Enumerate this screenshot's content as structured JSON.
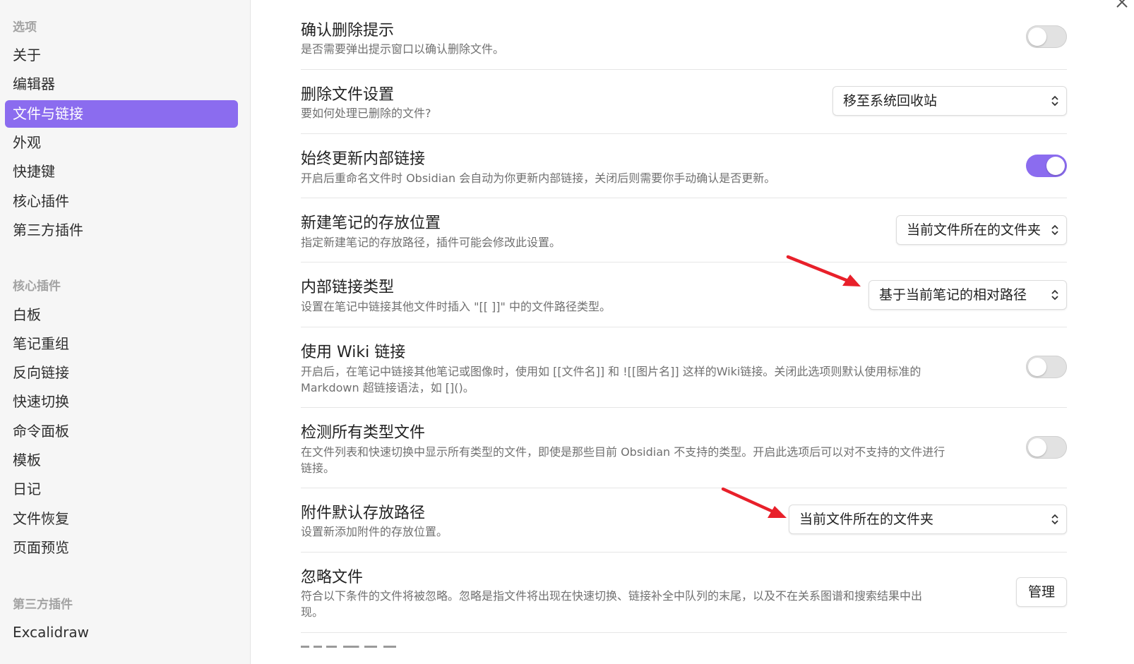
{
  "sidebar": {
    "options_heading": "选项",
    "options_items": [
      "关于",
      "编辑器",
      "文件与链接",
      "外观",
      "快捷键",
      "核心插件",
      "第三方插件"
    ],
    "active_item": "文件与链接",
    "core_heading": "核心插件",
    "core_items": [
      "白板",
      "笔记重组",
      "反向链接",
      "快速切换",
      "命令面板",
      "模板",
      "日记",
      "文件恢复",
      "页面预览"
    ],
    "third_heading": "第三方插件",
    "third_items": [
      "Excalidraw"
    ]
  },
  "settings": {
    "confirm_delete": {
      "title": "确认删除提示",
      "desc": "是否需要弹出提示窗口以确认删除文件。",
      "enabled": false
    },
    "delete_files": {
      "title": "删除文件设置",
      "desc": "要如何处理已删除的文件?",
      "value": "移至系统回收站"
    },
    "update_links": {
      "title": "始终更新内部链接",
      "desc": "开启后重命名文件时 Obsidian 会自动为你更新内部链接，关闭后则需要你手动确认是否更新。",
      "enabled": true
    },
    "new_note_location": {
      "title": "新建笔记的存放位置",
      "desc": "指定新建笔记的存放路径，插件可能会修改此设置。",
      "value": "当前文件所在的文件夹"
    },
    "link_format": {
      "title": "内部链接类型",
      "desc": "设置在笔记中链接其他文件时插入 \"[[ ]]\" 中的文件路径类型。",
      "value": "基于当前笔记的相对路径"
    },
    "wiki_links": {
      "title": "使用 Wiki 链接",
      "desc_line1": "开启后，在笔记中链接其他笔记或图像时，使用如 [[文件名]] 和 ![[图片名]] 这样的Wiki链接。关闭此选项则默认使用标准的",
      "desc_line2": "Markdown 超链接语法，如 []()。",
      "enabled": false
    },
    "detect_all_files": {
      "title": "检测所有类型文件",
      "desc_line1": "在文件列表和快速切换中显示所有类型的文件，即使是那些目前 Obsidian 不支持的类型。开启此选项后可以对不支持的文件进行",
      "desc_line2": "链接。",
      "enabled": false
    },
    "attachment_path": {
      "title": "附件默认存放路径",
      "desc": "设置新添加附件的存放位置。",
      "value": "当前文件所在的文件夹"
    },
    "ignore_files": {
      "title": "忽略文件",
      "desc_line1": "符合以下条件的文件将被忽略。忽略是指文件将出现在快速切换、链接补全中队列的末尾，以及不在关系图谱和搜索结果中出",
      "desc_line2": "现。",
      "button": "管理"
    }
  },
  "colors": {
    "accent": "#8b6cef",
    "annotation_arrow": "#e8202a"
  },
  "icons": {
    "close": "close-icon",
    "dropdown": "chevron-up-down-icon"
  }
}
